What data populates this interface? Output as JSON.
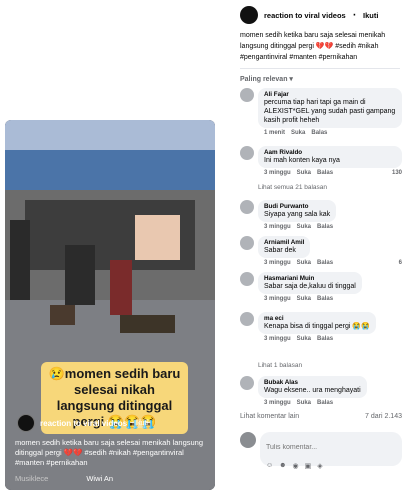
{
  "post": {
    "author": "reaction to viral videos",
    "follow": "Ikuti",
    "text": "momen sedih ketika baru saja selesai menikah langsung ditinggal pergi 💔💔 #sedih #nikah #pengantinviral #manten #pernikahan",
    "sort_label": "Paling relevan"
  },
  "video": {
    "caption": "😢momen sedih baru selesai nikah langsung ditinggal pergi 😭😭😭",
    "overlay_top": "😭momen sedih",
    "author": "reaction to viral videos",
    "follow": "Ikuti",
    "text": "momen sedih ketika baru saja selesai menikah langsung ditinggal pergi 💔💔 #sedih #nikah #pengantinviral #manten #pernikahan",
    "bottom_left": "Musiklece",
    "bottom_right": "Wiwi An"
  },
  "comments": [
    {
      "name": "Ali Fajar",
      "text": "percuma tiap hari tapi ga main di ALEXIST*GEL yang sudah pasti gampang kasih profit heheh",
      "time": "1 menit",
      "like": "Suka",
      "reply": "Balas",
      "reactions": ""
    },
    {
      "name": "Aam Rivaldo",
      "text": "Ini mah konten kaya nya",
      "time": "3 minggu",
      "like": "Suka",
      "reply": "Balas",
      "reactions": "130"
    },
    {
      "name": "Budi Purwanto",
      "text": "Siyapa yang sala kak",
      "time": "3 minggu",
      "like": "Suka",
      "reply": "Balas",
      "reactions": ""
    },
    {
      "name": "Arniamil Amil",
      "text": "Sabar dek",
      "time": "3 minggu",
      "like": "Suka",
      "reply": "Balas",
      "reactions": "6"
    },
    {
      "name": "Hasmariani Muin",
      "text": "Sabar saja de,kaluu di tinggal",
      "time": "3 minggu",
      "like": "Suka",
      "reply": "Balas",
      "reactions": ""
    },
    {
      "name": "ma eci",
      "text": "Kenapa bisa di tinggal pergi 😭😭",
      "time": "3 minggu",
      "like": "Suka",
      "reply": "Balas",
      "reactions": ""
    },
    {
      "name": "Bubak Alas",
      "text": "Wagu eksene.. ura menghayati",
      "time": "3 minggu",
      "like": "Suka",
      "reply": "Balas",
      "reactions": ""
    }
  ],
  "replies": {
    "second": "Lihat semua 21 balasan",
    "sixth": "Lihat 1 balasan"
  },
  "more": {
    "label": "Lihat komentar lain",
    "count": "7 dari 2.143"
  },
  "write": {
    "placeholder": "Tulis komentar..."
  },
  "colors": {
    "accent": "#1877f2",
    "bubble": "#f0f2f5",
    "caption_bg": "#f7d77a"
  }
}
